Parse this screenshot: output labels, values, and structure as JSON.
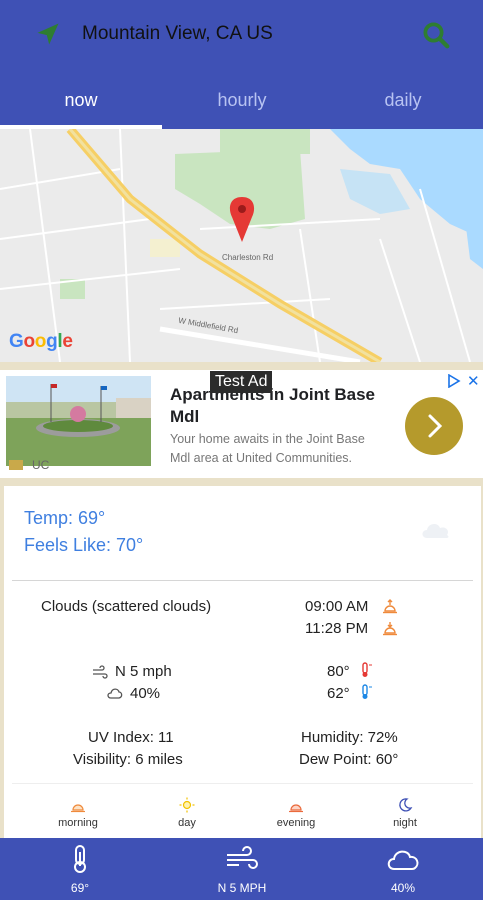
{
  "header": {
    "location": "Mountain View, CA US",
    "accent": "#3f51b5",
    "icon_color": "#2e7d32"
  },
  "tabs": [
    {
      "label": "now",
      "active": true
    },
    {
      "label": "hourly",
      "active": false
    },
    {
      "label": "daily",
      "active": false
    }
  ],
  "map": {
    "provider_logo": "Google",
    "street_labels": [
      "Charleston Rd",
      "W Middlefield Rd"
    ]
  },
  "ad": {
    "badge": "Test Ad",
    "title": "Apartments in Joint Base Mdl",
    "subtitle": "Your home awaits in the Joint Base Mdl area at United Communities.",
    "advertiser": "UC",
    "close": "✕"
  },
  "current": {
    "temp": "Temp: 69°",
    "feels_like": "Feels Like: 70°",
    "condition": "Clouds (scattered clouds)",
    "sunrise": "09:00 AM",
    "sunset": "11:28 PM",
    "wind": "N 5 mph",
    "cloud_cover": "40%",
    "high": "80°",
    "low": "62°",
    "uv_index": "UV Index: 11",
    "visibility": "Visibility: 6 miles",
    "humidity": "Humidity: 72%",
    "dew_point": "Dew Point: 60°"
  },
  "periods": [
    "morning",
    "day",
    "evening",
    "night"
  ],
  "bottom_bar": {
    "temp": "69°",
    "wind": "N 5 MPH",
    "clouds": "40%"
  }
}
